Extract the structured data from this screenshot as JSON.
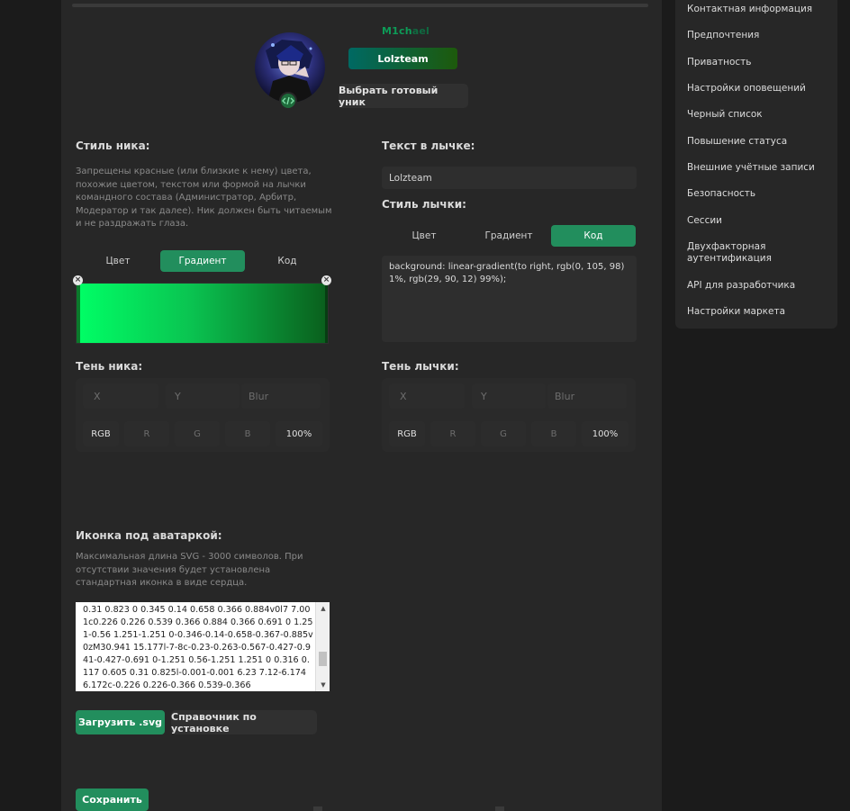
{
  "profile": {
    "nickname": "M1ch",
    "nickname_faded": "ael",
    "badge_text": "Lolzteam",
    "choose_unique_button": "Выбрать готовый уник"
  },
  "nick_style": {
    "title": "Стиль ника:",
    "description": "Запрещены красные (или близкие к нему) цвета, похожие цветом, текстом или формой на лычки командного состава (Администратор, Арбитр, Модератор и так далее). Ник должен быть читаемым и не раздражать глаза.",
    "tabs": [
      "Цвет",
      "Градиент",
      "Код"
    ],
    "active_tab": "Градиент",
    "gradient_handle_close": "×"
  },
  "badge_text_section": {
    "title": "Текст в лычке:",
    "value": "Lolzteam"
  },
  "badge_style": {
    "title": "Стиль лычки:",
    "tabs": [
      "Цвет",
      "Градиент",
      "Код"
    ],
    "active_tab": "Код",
    "code": "background: linear-gradient(to right, rgb(0, 105, 98) 1%, rgb(29, 90, 12) 99%);"
  },
  "nick_shadow": {
    "title": "Тень ника:",
    "x_placeholder": "X",
    "y_placeholder": "Y",
    "blur_placeholder": "Blur",
    "rgb_label": "RGB",
    "r": "R",
    "g": "G",
    "b": "B",
    "opacity": "100%"
  },
  "badge_shadow": {
    "title": "Тень лычки:",
    "x_placeholder": "X",
    "y_placeholder": "Y",
    "blur_placeholder": "Blur",
    "rgb_label": "RGB",
    "r": "R",
    "g": "G",
    "b": "B",
    "opacity": "100%"
  },
  "avatar_icon": {
    "title": "Иконка под аватаркой:",
    "description": "Максимальная длина SVG - 3000 символов. При отсутствии значения будет установлена стандартная иконка в виде сердца.",
    "svg_code": "0.31 0.823 0 0.345 0.14 0.658 0.366 0.884v0l7 7.001c0.226 0.226 0.539 0.366 0.884 0.366 0.691 0 1.251-0.56 1.251-1.251 0-0.346-0.14-0.658-0.367-0.885v0zM30.941 15.177l-7-8c-0.23-0.263-0.567-0.427-0.941-0.427-0.691 0-1.251 0.56-1.251 1.251 0 0.316 0.117 0.605 0.31 0.825l-0.001-0.001 6.23 7.12-6.174 6.172c-0.226 0.226-0.366 0.539-0.366",
    "upload_button": "Загрузить .svg",
    "guide_button": "Справочник по установке"
  },
  "save_button": "Сохранить",
  "sidebar": {
    "items": [
      "Контактная информация",
      "Предпочтения",
      "Приватность",
      "Настройки оповещений",
      "Черный список",
      "Повышение статуса",
      "Внешние учётные записи",
      "Безопасность",
      "Сессии",
      "Двухфакторная аутентификация",
      "API для разработчика",
      "Настройки маркета"
    ]
  },
  "colors": {
    "accent": "#228e5d",
    "badge_gradient_start": "#006962",
    "badge_gradient_end": "#1d5a0c",
    "nick_gradient_start": "#00ff66",
    "nick_gradient_end": "#0a5e1c"
  }
}
